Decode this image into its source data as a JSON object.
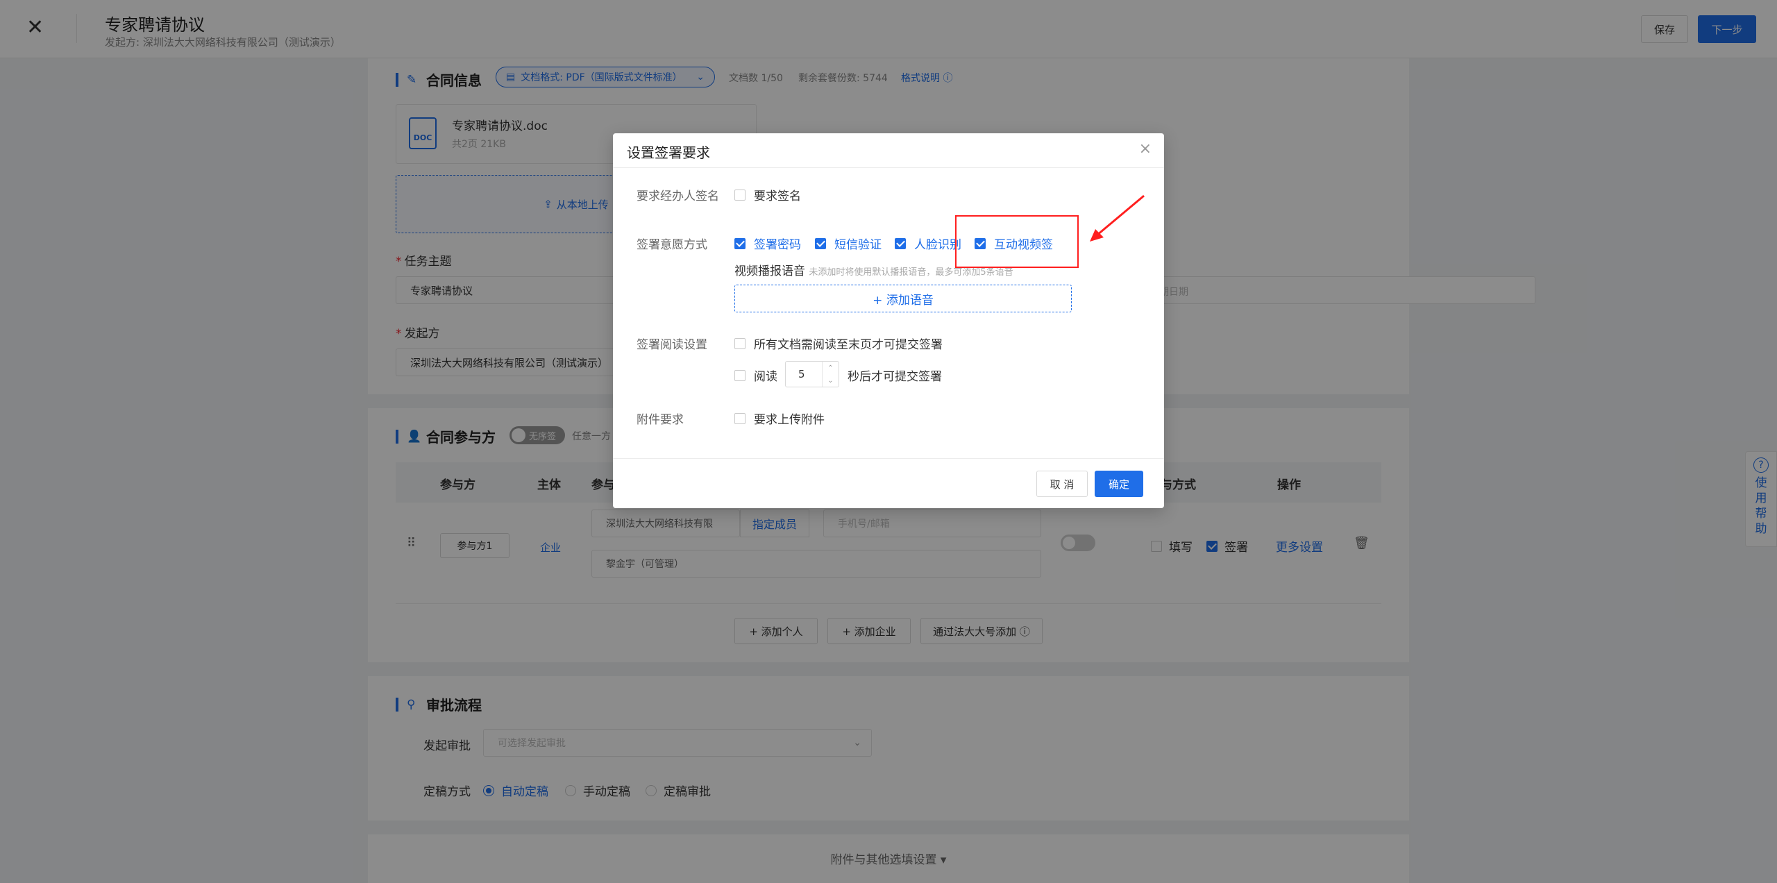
{
  "header": {
    "title": "专家聘请协议",
    "subtitle": "发起方: 深圳法大大网络科技有限公司（测试演示）",
    "save_label": "保存",
    "next_label": "下一步"
  },
  "contract_info": {
    "title": "合同信息",
    "format_label": "文档格式: PDF（国际版式文件标准）",
    "doc_count": "文档数 1/50",
    "remaining": "剩余套餐份数: 5744",
    "format_help": "格式说明",
    "file_name": "专家聘请协议.doc",
    "file_meta": "共2页    21KB",
    "file_badge": "DOC",
    "upload_label": "从本地上传",
    "task_subject_label": "任务主题",
    "task_subject_value": "专家聘请协议",
    "initiator_label": "发起方",
    "initiator_value": "深圳法大大网络科技有限公司（测试演示）",
    "date_placeholder_tail": "期日期"
  },
  "participants": {
    "title": "合同参与方",
    "toggle_label": "无序签",
    "toggle_hint": "任意一方",
    "columns": [
      "参与方",
      "主体",
      "参与",
      "与方式",
      "操作"
    ],
    "row": {
      "party": "参与方1",
      "entity": "企业",
      "company": "深圳法大大网络科技有限",
      "assign": "指定成员",
      "contact_placeholder": "手机号/邮箱",
      "member": "黎金宇（可管理）",
      "fill_label": "填写",
      "sign_label": "签署",
      "more": "更多设置"
    },
    "add_person": "+ 添加个人",
    "add_company": "+ 添加企业",
    "add_via_account": "通过法大大号添加"
  },
  "approval": {
    "title": "审批流程",
    "initiate_label": "发起审批",
    "initiate_placeholder": "可选择发起审批",
    "finalize_label": "定稿方式",
    "options": [
      "自动定稿",
      "手动定稿",
      "定稿审批"
    ]
  },
  "footer_section": {
    "label": "附件与其他选填设置"
  },
  "help": {
    "label": "使用帮助"
  },
  "modal": {
    "title": "设置签署要求",
    "require_sign_label": "要求经办人签名",
    "require_sign_option": "要求签名",
    "willingness_label": "签署意愿方式",
    "willingness_options": [
      "签署密码",
      "短信验证",
      "人脸识别",
      "互动视频签"
    ],
    "voice_label": "视频播报语音",
    "voice_hint": "未添加时将使用默认播报语音，最多可添加5条语音",
    "add_voice": "+ 添加语音",
    "read_label": "签署阅读设置",
    "read_option_1": "所有文档需阅读至末页才可提交签署",
    "read_prefix": "阅读",
    "read_seconds": "5",
    "read_suffix": "秒后才可提交签署",
    "attach_label": "附件要求",
    "attach_option": "要求上传附件",
    "cancel": "取 消",
    "ok": "确定"
  }
}
